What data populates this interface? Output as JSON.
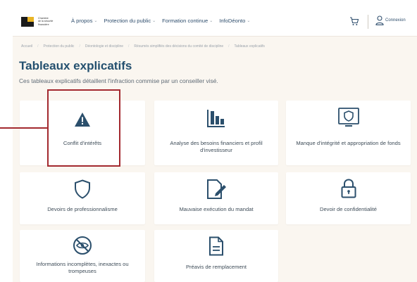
{
  "header": {
    "logo_lines": [
      "Chambre",
      "de la sécurité",
      "financière"
    ],
    "nav": [
      {
        "label": "À propos"
      },
      {
        "label": "Protection du public"
      },
      {
        "label": "Formation continue"
      },
      {
        "label": "InfoDéonto"
      }
    ],
    "icons": {
      "cart": "cart-icon",
      "user": "user-icon",
      "chevron": "chevron-down-icon"
    },
    "login_label": "Connexion"
  },
  "breadcrumb": [
    "Accueil",
    "Protection du public",
    "Déontologie et discipline",
    "Résumés simplifiés des décisions du comité de discipline",
    "Tableaux explicatifs"
  ],
  "page": {
    "title": "Tableaux explicatifs",
    "subtitle": "Ces tableaux explicatifs détaillent l'infraction commise par un conseiller visé."
  },
  "cards": [
    {
      "label": "Conflit d'intérêts",
      "icon": "warning-triangle-icon"
    },
    {
      "label": "Analyse des besoins financiers et profil d'investisseur",
      "icon": "bar-chart-icon"
    },
    {
      "label": "Manque d'intégrité et appropriation de fonds",
      "icon": "shield-monitor-icon"
    },
    {
      "label": "Devoirs de professionnalisme",
      "icon": "shield-icon"
    },
    {
      "label": "Mauvaise exécution du mandat",
      "icon": "document-pen-icon"
    },
    {
      "label": "Devoir de confidentialité",
      "icon": "lock-icon"
    },
    {
      "label": "Informations incomplètes, inexactes ou trompeuses",
      "icon": "no-view-icon"
    },
    {
      "label": "Préavis de remplacement",
      "icon": "document-icon"
    }
  ],
  "colors": {
    "accent": "#24506f",
    "highlight": "#a3292f",
    "background": "#faf6f0",
    "logo_gold": "#e9b526"
  }
}
